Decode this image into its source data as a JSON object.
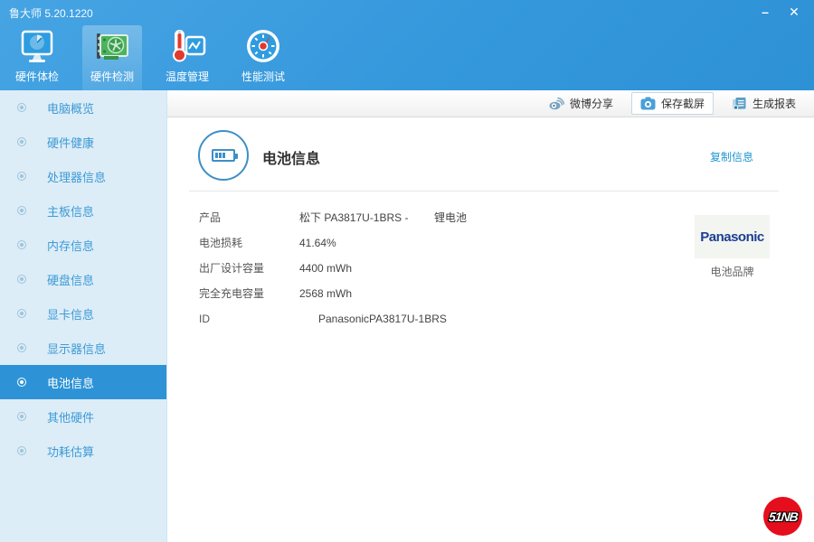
{
  "window": {
    "title": "鲁大师 5.20.1220",
    "minimize_glyph": "–",
    "close_glyph": "✕"
  },
  "toolbar": {
    "active_index": 1,
    "tabs": [
      {
        "label": "硬件体检",
        "icon": "monitor-radar-icon"
      },
      {
        "label": "硬件检测",
        "icon": "gpu-card-icon"
      },
      {
        "label": "温度管理",
        "icon": "thermometer-chart-icon"
      },
      {
        "label": "性能测试",
        "icon": "gauge-icon"
      }
    ]
  },
  "actionbar": {
    "items": [
      {
        "label": "微博分享",
        "icon": "weibo-icon"
      },
      {
        "label": "保存截屏",
        "icon": "camera-icon"
      },
      {
        "label": "生成报表",
        "icon": "report-icon"
      }
    ]
  },
  "sidebar": {
    "items": [
      {
        "label": "电脑概览"
      },
      {
        "label": "硬件健康"
      },
      {
        "label": "处理器信息"
      },
      {
        "label": "主板信息"
      },
      {
        "label": "内存信息"
      },
      {
        "label": "硬盘信息"
      },
      {
        "label": "显卡信息"
      },
      {
        "label": "显示器信息"
      },
      {
        "label": "电池信息",
        "selected": true
      },
      {
        "label": "其他硬件"
      },
      {
        "label": "功耗估算"
      }
    ]
  },
  "main": {
    "header": {
      "title": "电池信息",
      "icon": "battery-icon",
      "copy_link": "复制信息"
    },
    "table_rows": [
      {
        "label": "产品",
        "value": "松下 PA3817U-1BRS -",
        "value2": "锂电池"
      },
      {
        "label": "电池损耗",
        "value": "41.64%"
      },
      {
        "label": "出厂设计容量",
        "value": "4400 mWh"
      },
      {
        "label": "完全充电容量",
        "value": "2568 mWh"
      },
      {
        "label": "ID",
        "value": "PanasonicPA3817U-1BRS",
        "indent": true
      }
    ],
    "brand": {
      "logo_text": "Panasonic",
      "caption": "电池品牌"
    }
  },
  "badge": {
    "text": "51NB"
  },
  "colors": {
    "header_blue": "#3598dc",
    "accent_blue": "#2e93d6",
    "sidebar_bg": "#dcedf8",
    "sidebar_text": "#3e9ad4",
    "link_blue": "#2596d1",
    "panasonic_navy": "#1c3f94",
    "badge_red": "#e50e1c"
  }
}
